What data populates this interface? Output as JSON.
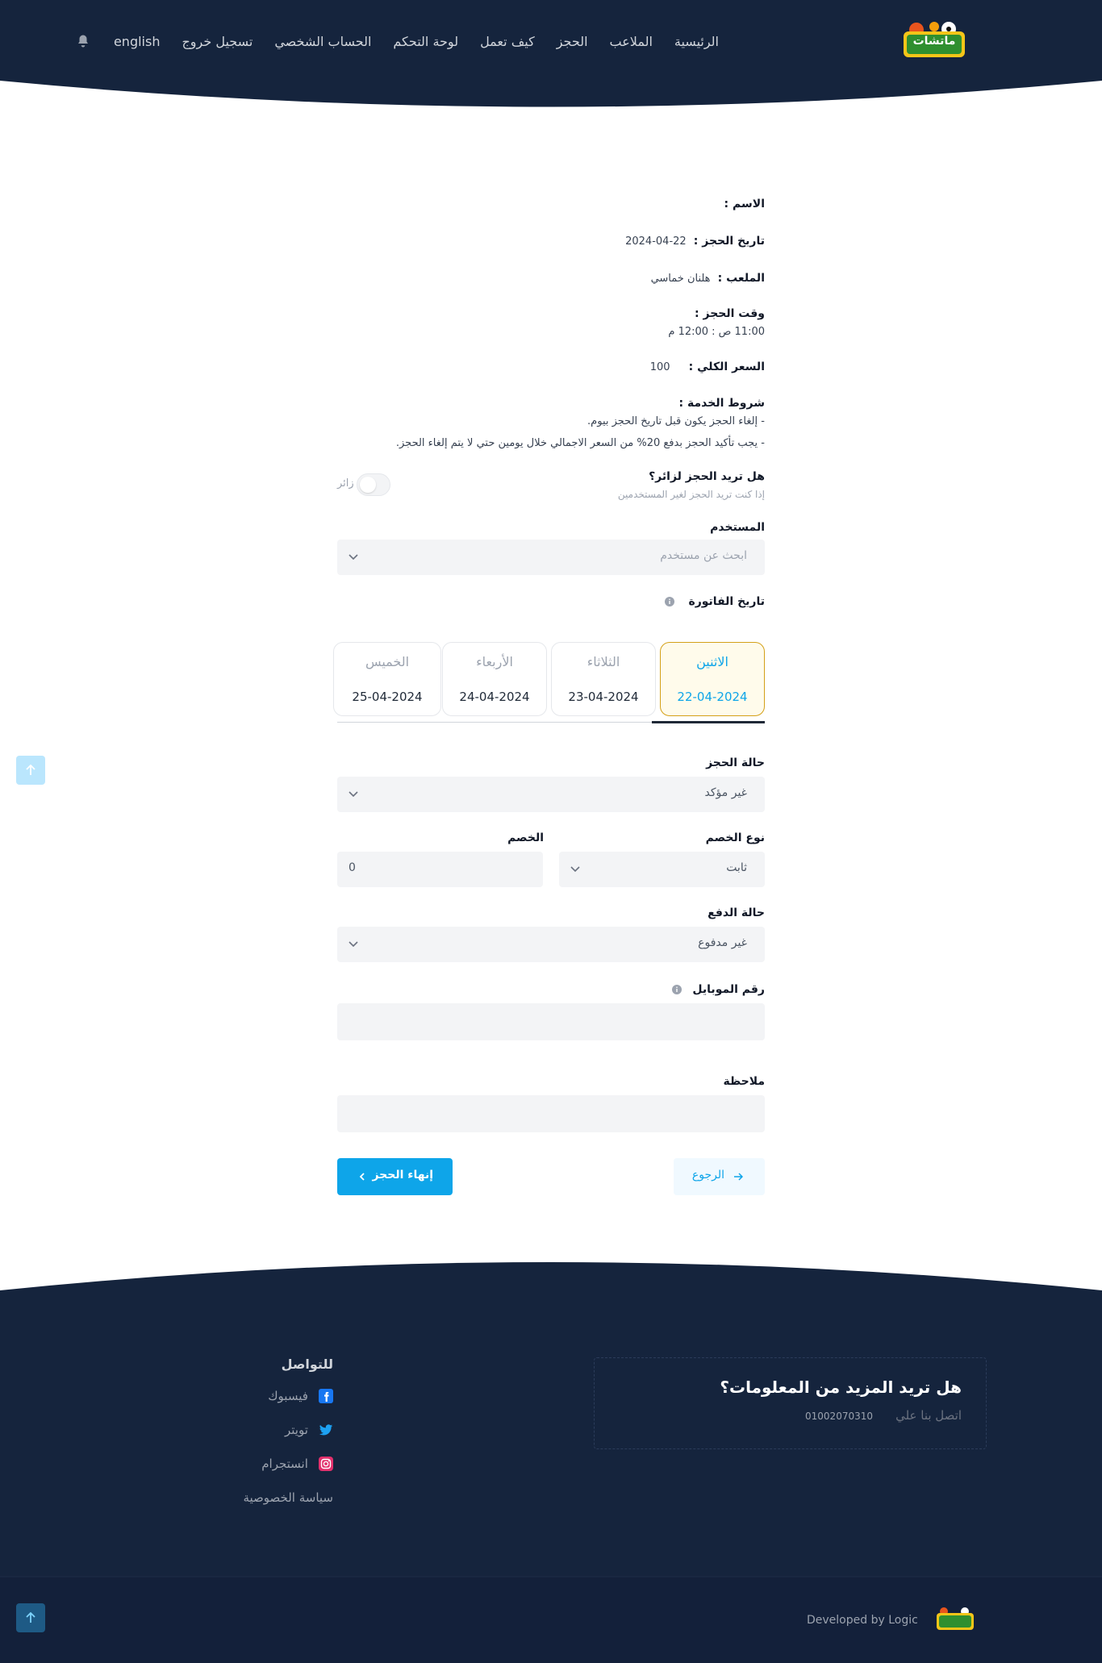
{
  "nav": {
    "brand": "ماتشات",
    "items": [
      "الرئيسية",
      "الملاعب",
      "الحجز",
      "كيف تعمل",
      "لوحة التحكم",
      "الحساب الشخصي",
      "تسجيل خروج",
      "english"
    ]
  },
  "booking": {
    "name_label": "الاسم :",
    "date_label": "تاريخ الحجز :",
    "date_value": "22-04-2024",
    "stadium_label": "الملعب :",
    "stadium_value": "هلنان خماسي",
    "time_label": "وقت الحجز :",
    "time_value": "11:00 ص : 12:00 م",
    "price_label": "السعر الكلي :",
    "price_value": "100",
    "terms_label": "شروط الخدمة :",
    "terms": [
      "- إلغاء الحجز يكون قبل تاريخ الحجز بيوم.",
      "- يجب تأكيد الحجز بدفع 20% من السعر الاجمالي خلال يومين حتي لا يتم إلغاء الحجز."
    ]
  },
  "visitor": {
    "question": "هل تريد الحجز لزائر؟",
    "hint": "إذا كنت تريد الحجز لغير المستخدمين",
    "toggle_label": "زائر"
  },
  "user_field": {
    "label": "المستخدم",
    "placeholder": "ابحث عن مستخدم"
  },
  "invoice": {
    "label": "تاريخ الفاتورة",
    "days": [
      {
        "day": "الاثنين",
        "date": "22-04-2024",
        "active": true
      },
      {
        "day": "الثلاثاء",
        "date": "23-04-2024",
        "active": false
      },
      {
        "day": "الأربعاء",
        "date": "24-04-2024",
        "active": false
      },
      {
        "day": "الخميس",
        "date": "25-04-2024",
        "active": false
      }
    ]
  },
  "status": {
    "label": "حالة الحجز",
    "value": "غير مؤكد"
  },
  "discount": {
    "type_label": "نوع الخصم",
    "type_value": "ثابت",
    "amount_label": "الخصم",
    "amount_value": "0"
  },
  "payment": {
    "label": "حالة الدفع",
    "value": "غير مدفوع"
  },
  "mobile": {
    "label": "رقم الموبايل"
  },
  "note": {
    "label": "ملاحظة"
  },
  "actions": {
    "finish": "إنهاء الحجز",
    "back": "الرجوع"
  },
  "footer": {
    "info_title": "هل تريد المزيد من المعلومات؟",
    "contact_label": "اتصل بنا علي",
    "phone": "01002070310",
    "social_title": "للتواصل",
    "facebook": "فيسبوك",
    "twitter": "تويتر",
    "instagram": "انستجرام",
    "privacy": "سياسة الخصوصية",
    "developed_by": "Developed by Logic"
  },
  "colors": {
    "navy": "#15243d",
    "accent": "#0ea5e9",
    "card_active_border": "#d4a017"
  }
}
